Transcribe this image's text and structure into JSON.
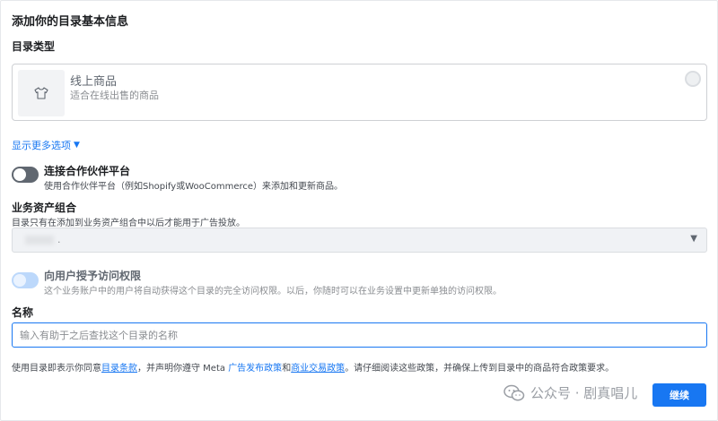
{
  "header": {
    "title": "添加你的目录基本信息"
  },
  "catalog_type": {
    "label": "目录类型",
    "option": {
      "title": "线上商品",
      "description": "适合在线出售的商品",
      "icon": "tshirt-icon",
      "selected": false
    },
    "show_more": "显示更多选项"
  },
  "partner": {
    "title": "连接合作伙伴平台",
    "description": "使用合作伙伴平台（例如Shopify或WooCommerce）来添加和更新商品。",
    "enabled": false
  },
  "business_portfolio": {
    "label": "业务资产组合",
    "help": "目录只有在添加到业务资产组合中以后才能用于广告投放。",
    "selected_value": "."
  },
  "access": {
    "title": "向用户授予访问权限",
    "description": "这个业务账户中的用户将自动获得这个目录的完全访问权限。以后，你随时可以在业务设置中更新单独的访问权限。",
    "enabled": true,
    "disabled": true
  },
  "name": {
    "label": "名称",
    "placeholder": "输入有助于之后查找这个目录的名称",
    "value": ""
  },
  "terms": {
    "prefix": "使用目录即表示你同意",
    "terms_link": "目录条款",
    "mid1": "，并声明你遵守 Meta ",
    "ad_policy_link": "广告发布政策",
    "and": "和",
    "commerce_policy_link": "商业交易政策",
    "suffix": "。请仔细阅读这些政策，并确保上传到目录中的商品符合政策要求。"
  },
  "footer": {
    "continue_label": "继续",
    "watermark_text": "公众号 · 剧真唱儿"
  },
  "colors": {
    "accent": "#1877f2",
    "toggle_off": "#606770",
    "toggle_disabled_on": "#bcd8fb"
  }
}
